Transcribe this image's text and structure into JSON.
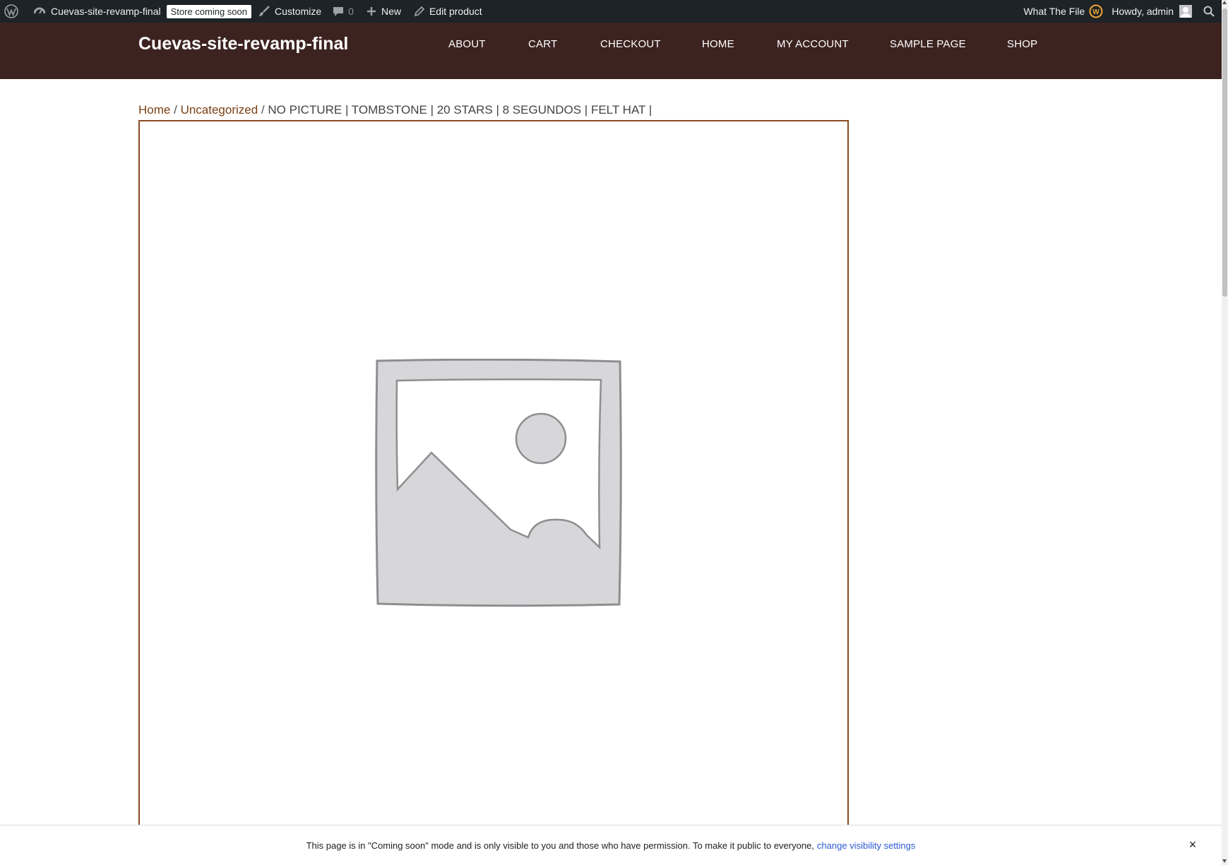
{
  "admin_bar": {
    "site_name": "Cuevas-site-revamp-final",
    "store_badge": "Store coming soon",
    "customize": "Customize",
    "comments_count": "0",
    "new": "New",
    "edit_product": "Edit product",
    "plugin_name": "What The File",
    "howdy": "Howdy, admin"
  },
  "header": {
    "site_title": "Cuevas-site-revamp-final",
    "nav": [
      "ABOUT",
      "CART",
      "CHECKOUT",
      "HOME",
      "MY ACCOUNT",
      "SAMPLE PAGE",
      "SHOP"
    ]
  },
  "breadcrumb": {
    "home": "Home",
    "separator": "/",
    "category": "Uncategorized",
    "current": "NO PICTURE | TOMBSTONE | 20 STARS | 8 SEGUNDOS | FELT HAT |"
  },
  "notice": {
    "text": "This page is in \"Coming soon\" mode and is only visible to you and those who have permission. To make it public to everyone,",
    "link": "change visibility settings",
    "close": "×"
  },
  "colors": {
    "admin_bar": "#1d2327",
    "header": "#3c2320",
    "accent_link": "#7b3f12",
    "frame_border": "#8a4a22",
    "notice_link": "#2f5bd2"
  }
}
